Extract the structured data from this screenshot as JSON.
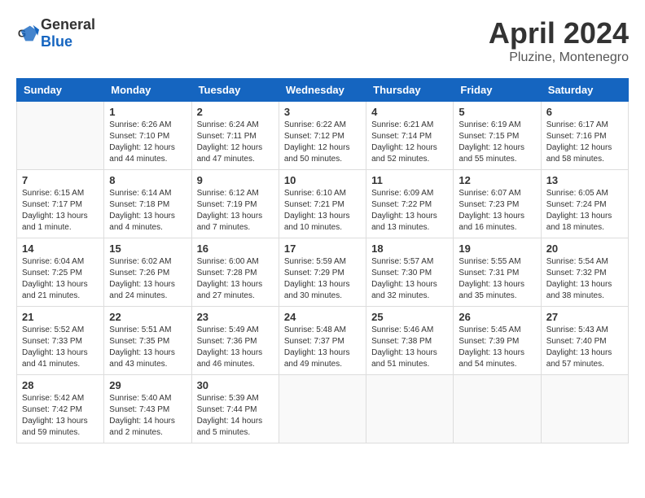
{
  "logo": {
    "text_general": "General",
    "text_blue": "Blue"
  },
  "title": "April 2024",
  "location": "Pluzine, Montenegro",
  "days_of_week": [
    "Sunday",
    "Monday",
    "Tuesday",
    "Wednesday",
    "Thursday",
    "Friday",
    "Saturday"
  ],
  "weeks": [
    [
      {
        "day": "",
        "info": ""
      },
      {
        "day": "1",
        "info": "Sunrise: 6:26 AM\nSunset: 7:10 PM\nDaylight: 12 hours\nand 44 minutes."
      },
      {
        "day": "2",
        "info": "Sunrise: 6:24 AM\nSunset: 7:11 PM\nDaylight: 12 hours\nand 47 minutes."
      },
      {
        "day": "3",
        "info": "Sunrise: 6:22 AM\nSunset: 7:12 PM\nDaylight: 12 hours\nand 50 minutes."
      },
      {
        "day": "4",
        "info": "Sunrise: 6:21 AM\nSunset: 7:14 PM\nDaylight: 12 hours\nand 52 minutes."
      },
      {
        "day": "5",
        "info": "Sunrise: 6:19 AM\nSunset: 7:15 PM\nDaylight: 12 hours\nand 55 minutes."
      },
      {
        "day": "6",
        "info": "Sunrise: 6:17 AM\nSunset: 7:16 PM\nDaylight: 12 hours\nand 58 minutes."
      }
    ],
    [
      {
        "day": "7",
        "info": "Sunrise: 6:15 AM\nSunset: 7:17 PM\nDaylight: 13 hours\nand 1 minute."
      },
      {
        "day": "8",
        "info": "Sunrise: 6:14 AM\nSunset: 7:18 PM\nDaylight: 13 hours\nand 4 minutes."
      },
      {
        "day": "9",
        "info": "Sunrise: 6:12 AM\nSunset: 7:19 PM\nDaylight: 13 hours\nand 7 minutes."
      },
      {
        "day": "10",
        "info": "Sunrise: 6:10 AM\nSunset: 7:21 PM\nDaylight: 13 hours\nand 10 minutes."
      },
      {
        "day": "11",
        "info": "Sunrise: 6:09 AM\nSunset: 7:22 PM\nDaylight: 13 hours\nand 13 minutes."
      },
      {
        "day": "12",
        "info": "Sunrise: 6:07 AM\nSunset: 7:23 PM\nDaylight: 13 hours\nand 16 minutes."
      },
      {
        "day": "13",
        "info": "Sunrise: 6:05 AM\nSunset: 7:24 PM\nDaylight: 13 hours\nand 18 minutes."
      }
    ],
    [
      {
        "day": "14",
        "info": "Sunrise: 6:04 AM\nSunset: 7:25 PM\nDaylight: 13 hours\nand 21 minutes."
      },
      {
        "day": "15",
        "info": "Sunrise: 6:02 AM\nSunset: 7:26 PM\nDaylight: 13 hours\nand 24 minutes."
      },
      {
        "day": "16",
        "info": "Sunrise: 6:00 AM\nSunset: 7:28 PM\nDaylight: 13 hours\nand 27 minutes."
      },
      {
        "day": "17",
        "info": "Sunrise: 5:59 AM\nSunset: 7:29 PM\nDaylight: 13 hours\nand 30 minutes."
      },
      {
        "day": "18",
        "info": "Sunrise: 5:57 AM\nSunset: 7:30 PM\nDaylight: 13 hours\nand 32 minutes."
      },
      {
        "day": "19",
        "info": "Sunrise: 5:55 AM\nSunset: 7:31 PM\nDaylight: 13 hours\nand 35 minutes."
      },
      {
        "day": "20",
        "info": "Sunrise: 5:54 AM\nSunset: 7:32 PM\nDaylight: 13 hours\nand 38 minutes."
      }
    ],
    [
      {
        "day": "21",
        "info": "Sunrise: 5:52 AM\nSunset: 7:33 PM\nDaylight: 13 hours\nand 41 minutes."
      },
      {
        "day": "22",
        "info": "Sunrise: 5:51 AM\nSunset: 7:35 PM\nDaylight: 13 hours\nand 43 minutes."
      },
      {
        "day": "23",
        "info": "Sunrise: 5:49 AM\nSunset: 7:36 PM\nDaylight: 13 hours\nand 46 minutes."
      },
      {
        "day": "24",
        "info": "Sunrise: 5:48 AM\nSunset: 7:37 PM\nDaylight: 13 hours\nand 49 minutes."
      },
      {
        "day": "25",
        "info": "Sunrise: 5:46 AM\nSunset: 7:38 PM\nDaylight: 13 hours\nand 51 minutes."
      },
      {
        "day": "26",
        "info": "Sunrise: 5:45 AM\nSunset: 7:39 PM\nDaylight: 13 hours\nand 54 minutes."
      },
      {
        "day": "27",
        "info": "Sunrise: 5:43 AM\nSunset: 7:40 PM\nDaylight: 13 hours\nand 57 minutes."
      }
    ],
    [
      {
        "day": "28",
        "info": "Sunrise: 5:42 AM\nSunset: 7:42 PM\nDaylight: 13 hours\nand 59 minutes."
      },
      {
        "day": "29",
        "info": "Sunrise: 5:40 AM\nSunset: 7:43 PM\nDaylight: 14 hours\nand 2 minutes."
      },
      {
        "day": "30",
        "info": "Sunrise: 5:39 AM\nSunset: 7:44 PM\nDaylight: 14 hours\nand 5 minutes."
      },
      {
        "day": "",
        "info": ""
      },
      {
        "day": "",
        "info": ""
      },
      {
        "day": "",
        "info": ""
      },
      {
        "day": "",
        "info": ""
      }
    ]
  ]
}
